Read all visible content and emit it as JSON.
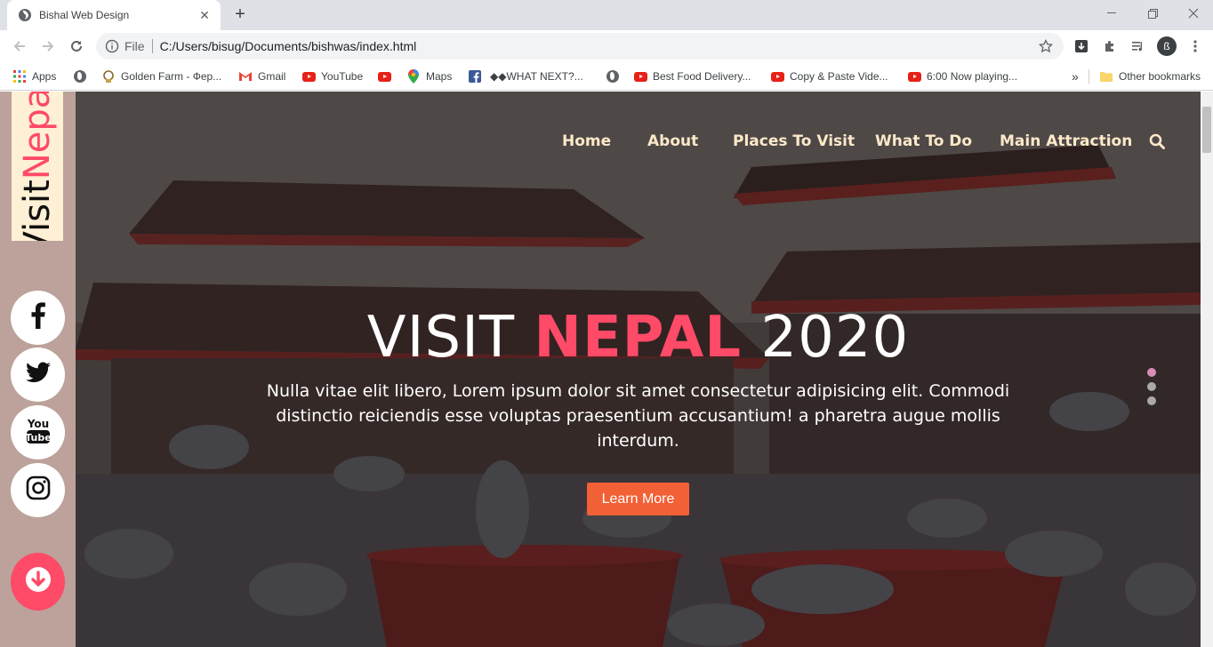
{
  "browser": {
    "tab_title": "Bishal Web Design",
    "new_tab": "+",
    "address_scheme": "File",
    "address_url": "C:/Users/bisug/Documents/bishwas/index.html",
    "profile_initial": "ß",
    "bookmarks": [
      {
        "label": "Apps",
        "icon": "apps-grid-icon"
      },
      {
        "label": "",
        "icon": "globe-icon"
      },
      {
        "label": "Golden Farm - Фер...",
        "icon": "golden-farm-icon"
      },
      {
        "label": "Gmail",
        "icon": "gmail-icon"
      },
      {
        "label": "YouTube",
        "icon": "youtube-icon"
      },
      {
        "label": "",
        "icon": "youtube-icon"
      },
      {
        "label": "Maps",
        "icon": "maps-pin-icon"
      },
      {
        "label": "",
        "icon": "facebook-icon"
      },
      {
        "label": "◆◆WHAT NEXT?...",
        "icon": ""
      },
      {
        "label": "",
        "icon": "globe-icon"
      },
      {
        "label": "Best Food Delivery...",
        "icon": "youtube-icon"
      },
      {
        "label": "Copy & Paste Vide...",
        "icon": "youtube-icon"
      },
      {
        "label": "6:00 Now playing...",
        "icon": "youtube-icon"
      }
    ],
    "overflow": "»",
    "other_bookmarks": "Other bookmarks"
  },
  "sidebar": {
    "logo_part1": "Visit",
    "logo_part2": "Nepal",
    "social": [
      "facebook-icon",
      "twitter-icon",
      "youtube-icon",
      "instagram-icon"
    ]
  },
  "nav": {
    "items": [
      "Home",
      "About",
      "Places To Visit",
      "What To Do",
      "Main Attraction"
    ]
  },
  "hero": {
    "title_part1": "VISIT",
    "title_accent": "NEPAL",
    "title_part2": "2020",
    "description": "Nulla vitae elit libero, Lorem ipsum dolor sit amet consectetur adipisicing elit. Commodi distinctio reiciendis esse voluptas praesentium accusantium! a pharetra augue mollis interdum.",
    "button": "Learn More",
    "slides": 3,
    "active_slide": 1
  },
  "colors": {
    "accent": "#ff4a68",
    "button": "#f26036",
    "nav_text": "#fde9c8",
    "logo_bg": "#fdf0d5",
    "sidebar_bg": "#bca29a"
  }
}
